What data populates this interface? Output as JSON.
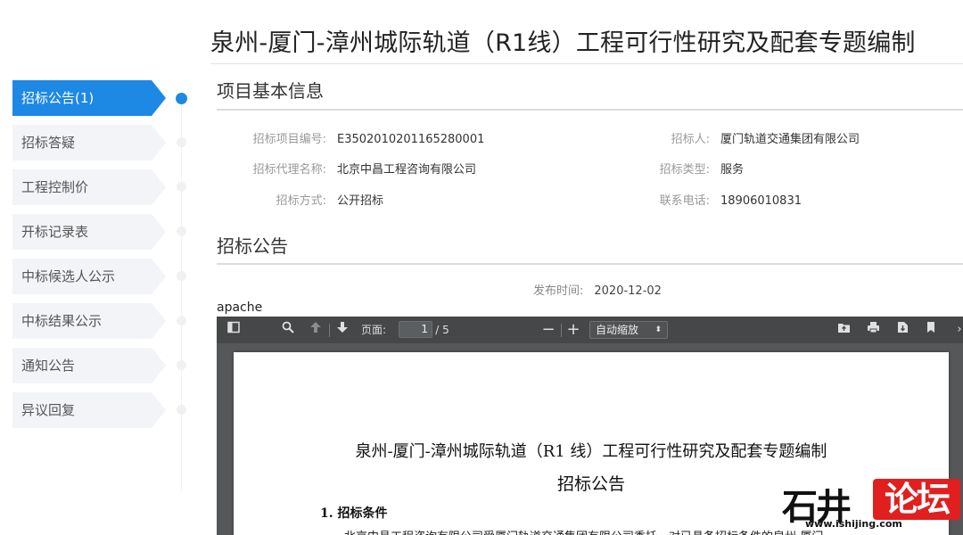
{
  "page_title": "泉州-厦门-漳州城际轨道（R1线）工程可行性研究及配套专题编制",
  "sidebar": {
    "items": [
      {
        "label": "招标公告(1)",
        "active": true
      },
      {
        "label": "招标答疑",
        "active": false
      },
      {
        "label": "工程控制价",
        "active": false
      },
      {
        "label": "开标记录表",
        "active": false
      },
      {
        "label": "中标候选人公示",
        "active": false
      },
      {
        "label": "中标结果公示",
        "active": false
      },
      {
        "label": "通知公告",
        "active": false
      },
      {
        "label": "异议回复",
        "active": false
      }
    ]
  },
  "project_info": {
    "heading": "项目基本信息",
    "project_no_label": "招标项目编号:",
    "project_no": "E3502010201165280001",
    "tenderer_label": "招标人:",
    "tenderer": "厦门轨道交通集团有限公司",
    "agent_label": "招标代理名称:",
    "agent": "北京中昌工程咨询有限公司",
    "type_label": "招标类型:",
    "type": "服务",
    "method_label": "招标方式:",
    "method": "公开招标",
    "phone_label": "联系电话:",
    "phone": "18906010831"
  },
  "announcement": {
    "heading": "招标公告",
    "publish_label": "发布时间:",
    "publish_date": "2020-12-02"
  },
  "viewer": {
    "frame_label": "apache",
    "page_label": "页面:",
    "current_page": "1",
    "total_pages": "/ 5",
    "zoom_value": "自动缩放",
    "doc_title": "泉州-厦门-漳州城际轨道（R1 线）工程可行性研究及配套专题编制",
    "doc_subtitle": "招标公告",
    "doc_section": "1. 招标条件",
    "doc_body": "北京中昌工程咨询有限公司受厦门轨道交通集团有限公司委托，对已具备招标条件的泉州-厦门"
  },
  "watermark": {
    "part1": "石井",
    "part2": "论坛",
    "url": "www.ishijing.com"
  },
  "colors": {
    "accent": "#1e88e5",
    "sidebar_bg": "#f2f4f7",
    "toolbar_bg": "#454749",
    "viewer_bg": "#555759",
    "watermark_red": "#e11f1f"
  }
}
